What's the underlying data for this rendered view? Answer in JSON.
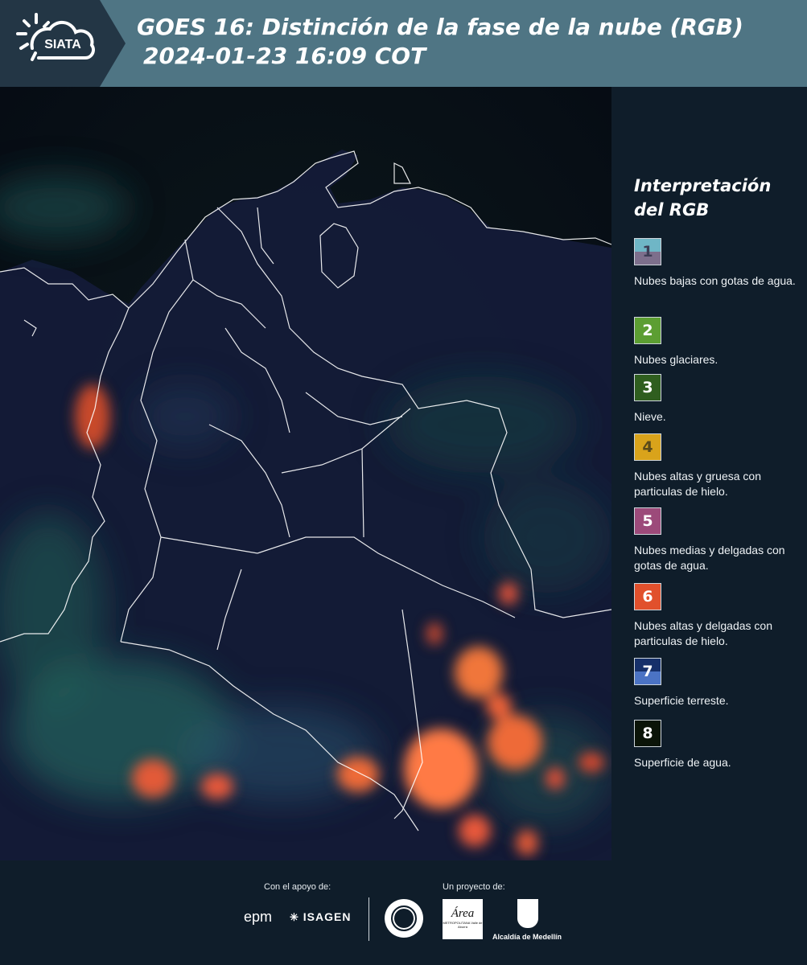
{
  "header": {
    "logo_text": "SIATA",
    "title_line1": "GOES 16: Distinción de la fase de la nube (RGB)",
    "title_line2": "2024-01-23 16:09 COT"
  },
  "legend": {
    "title_line1": "Interpretación",
    "title_line2": "del RGB",
    "items": [
      {
        "number": "1",
        "label": "Nubes bajas con gotas de agua.",
        "color_top": "#6fb6c6",
        "color_bottom": "#7d6f8c",
        "text_color": "#3d3d55"
      },
      {
        "number": "2",
        "label": "Nubes glaciares.",
        "color_top": "#5c9e32",
        "color_bottom": "#5c9e32",
        "text_color": "#ffffff"
      },
      {
        "number": "3",
        "label": "Nieve.",
        "color_top": "#2f5e1f",
        "color_bottom": "#2f5e1f",
        "text_color": "#ffffff"
      },
      {
        "number": "4",
        "label": "Nubes altas y gruesa con particulas de hielo.",
        "color_top": "#d9a31b",
        "color_bottom": "#d9a31b",
        "text_color": "#5a4a1a"
      },
      {
        "number": "5",
        "label": "Nubes medias y delgadas con gotas de agua.",
        "color_top": "#9c4a7a",
        "color_bottom": "#9c4a7a",
        "text_color": "#ffffff"
      },
      {
        "number": "6",
        "label": "Nubes altas y delgadas con particulas de hielo.",
        "color_top": "#e1502c",
        "color_bottom": "#e1502c",
        "text_color": "#ffffff"
      },
      {
        "number": "7",
        "label": "Superficie terreste.",
        "color_top": "#16306a",
        "color_bottom": "#4b73c4",
        "text_color": "#ffffff"
      },
      {
        "number": "8",
        "label": "Superficie de agua.",
        "color_top": "#0b1408",
        "color_bottom": "#0b1408",
        "text_color": "#ffffff"
      }
    ]
  },
  "footer": {
    "support_label": "Con el apoyo de:",
    "project_label": "Un proyecto de:",
    "sponsor_1": "epm",
    "sponsor_2": "ISAGEN",
    "partner_area": "Área",
    "partner_area_sub": "METROPOLITANA Valle de Aburrá",
    "partner_alcaldia": "Alcaldía de Medellín"
  }
}
